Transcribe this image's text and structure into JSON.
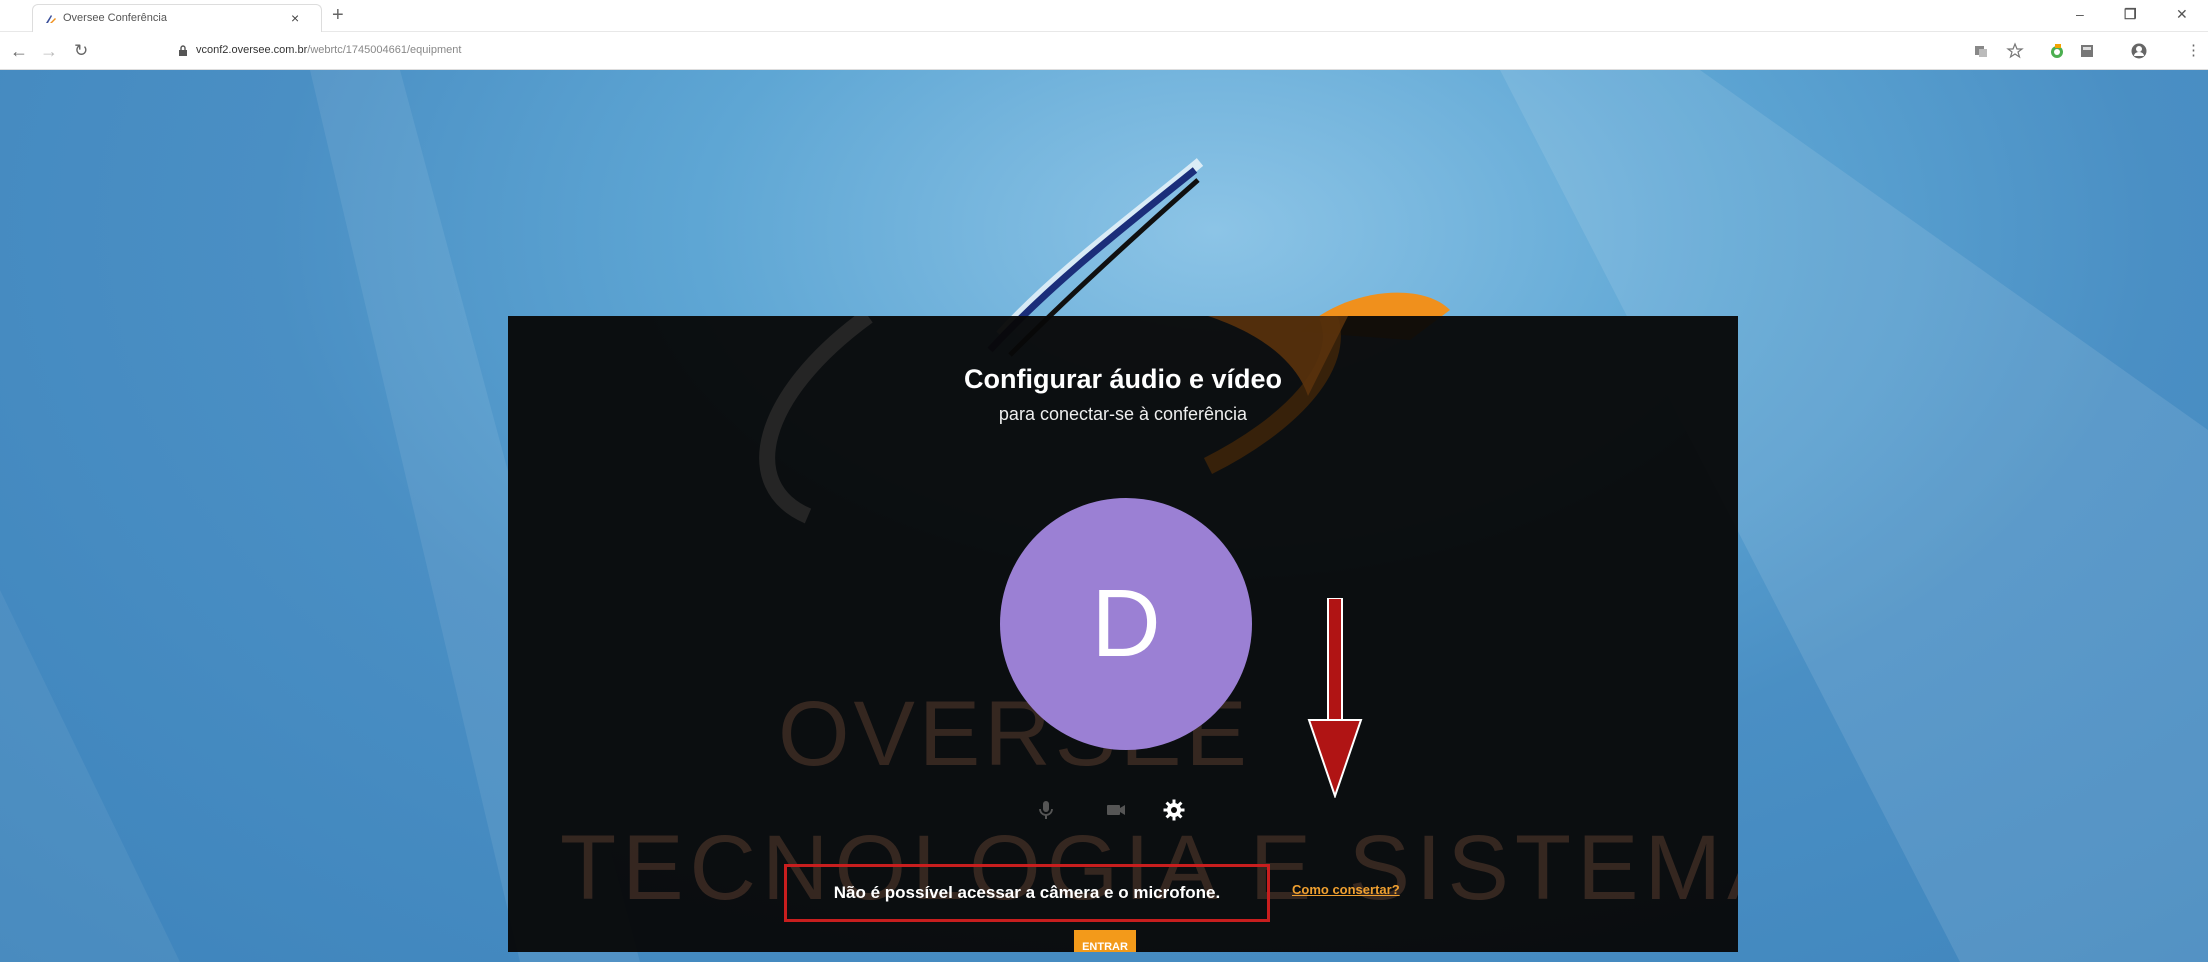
{
  "browser": {
    "tab_title": "Oversee Conferência",
    "url_host": "vconf2.oversee.com.br",
    "url_path": "/webrtc/1745004661/equipment"
  },
  "dialog": {
    "title": "Configurar áudio e vídeo",
    "subtitle": "para conectar-se à conferência",
    "avatar_initial": "D",
    "error_message": "Não é possível acessar a câmera e o microfone.",
    "fix_link": "Como consertar?",
    "enter_button": "ENTRAR",
    "watermark_line1": "OVERSEE",
    "watermark_line2": "TECNOLOGIA E SISTEMAS"
  },
  "colors": {
    "avatar": "#9b80d4",
    "enter_button": "#f39a1a",
    "link": "#f0a030",
    "highlight_box": "#c81e1e",
    "annotation_arrow": "#b01414"
  },
  "icons": [
    "microphone-icon",
    "camera-icon",
    "settings-gear-icon"
  ]
}
